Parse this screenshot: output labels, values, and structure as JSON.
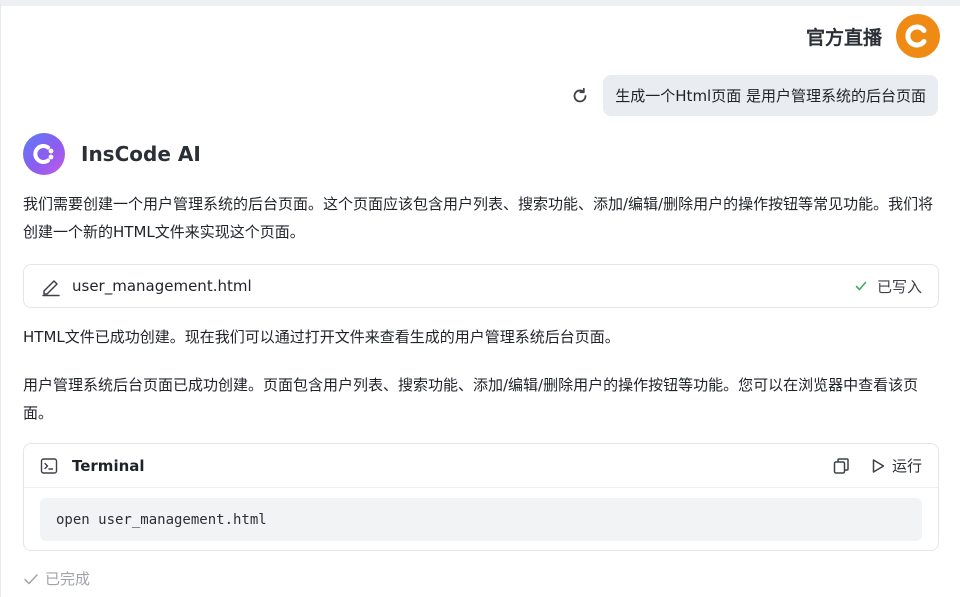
{
  "header": {
    "live_label": "官方直播",
    "logo_icon": "c-logo-icon",
    "logo_color": "#ef8a14"
  },
  "user_message": {
    "text": "生成一个Html页面 是用户管理系统的后台页面",
    "regenerate_icon": "refresh-icon"
  },
  "assistant": {
    "name": "InsCode AI",
    "paragraphs": [
      "我们需要创建一个用户管理系统的后台页面。这个页面应该包含用户列表、搜索功能、添加/编辑/删除用户的操作按钮等常见功能。我们将创建一个新的HTML文件来实现这个页面。",
      "HTML文件已成功创建。现在我们可以通过打开文件来查看生成的用户管理系统后台页面。",
      "用户管理系统后台页面已成功创建。页面包含用户列表、搜索功能、添加/编辑/删除用户的操作按钮等功能。您可以在浏览器中查看该页面。"
    ],
    "file_card": {
      "file_name": "user_management.html",
      "status": "已写入",
      "status_color": "#3fae62"
    },
    "terminal": {
      "title": "Terminal",
      "run_label": "运行",
      "command": "open user_management.html"
    },
    "done_label": "已完成"
  }
}
